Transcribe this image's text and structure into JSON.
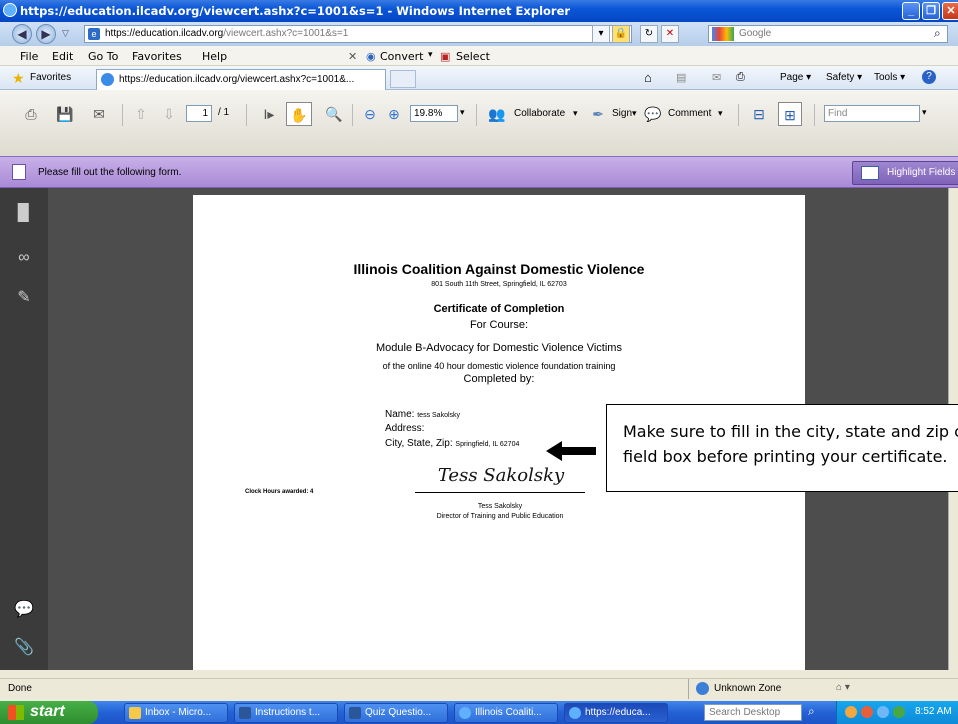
{
  "window": {
    "title": "https://education.ilcadv.org/viewcert.ashx?c=1001&s=1 - Windows Internet Explorer"
  },
  "address": {
    "url": "https://education.ilcadv.org/viewcert.ashx?c=1001&s=1",
    "url_prefix": "https://",
    "url_domain": "education.ilcadv.org",
    "url_path": "/viewcert.ashx?c=1001&s=1",
    "search_placeholder": "Google"
  },
  "menu": {
    "file": "File",
    "edit": "Edit",
    "goto": "Go To",
    "favorites": "Favorites",
    "help": "Help",
    "convert": "Convert",
    "select": "Select"
  },
  "favbar": {
    "favorites": "Favorites",
    "tab_label": "https://education.ilcadv.org/viewcert.ashx?c=1001&...",
    "page": "Page",
    "safety": "Safety",
    "tools": "Tools"
  },
  "pdf_toolbar": {
    "page_current": "1",
    "page_total": "/ 1",
    "zoom": "19.8%",
    "collaborate": "Collaborate",
    "sign": "Sign",
    "comment": "Comment",
    "find_placeholder": "Find"
  },
  "form_bar": {
    "message": "Please fill out the following form.",
    "highlight": "Highlight Fields"
  },
  "certificate": {
    "org": "Illinois Coalition Against Domestic Violence",
    "address": "801 South 11th Street, Springfield, IL  62703",
    "heading": "Certificate of Completion",
    "for_course": "For Course:",
    "course": "Module B-Advocacy for Domestic Violence Victims",
    "training": "of the online 40 hour domestic violence foundation training",
    "completed_by": "Completed by:",
    "name_label": "Name:",
    "name_value": "tess Sakolsky",
    "address_label": "Address:",
    "csz_label": "City, State, Zip:",
    "csz_value": "Springfield, IL  62704",
    "clock_hours": "Clock Hours awarded: 4",
    "signature": "Tess Sakolsky",
    "signer_name": "Tess Sakolsky",
    "signer_title": "Director of Training and Public Education"
  },
  "callout": {
    "line1": "Make sure to fill in the city, state and zip code",
    "line2": "field box before printing your certificate."
  },
  "status": {
    "text": "Done",
    "zone": "Unknown Zone"
  },
  "taskbar": {
    "start": "start",
    "tasks": [
      "Inbox - Micro...",
      "Instructions t...",
      "Quiz Questio...",
      "Illinois Coaliti...",
      "https://educa..."
    ],
    "search_placeholder": "Search Desktop",
    "clock": "8:52 AM"
  }
}
